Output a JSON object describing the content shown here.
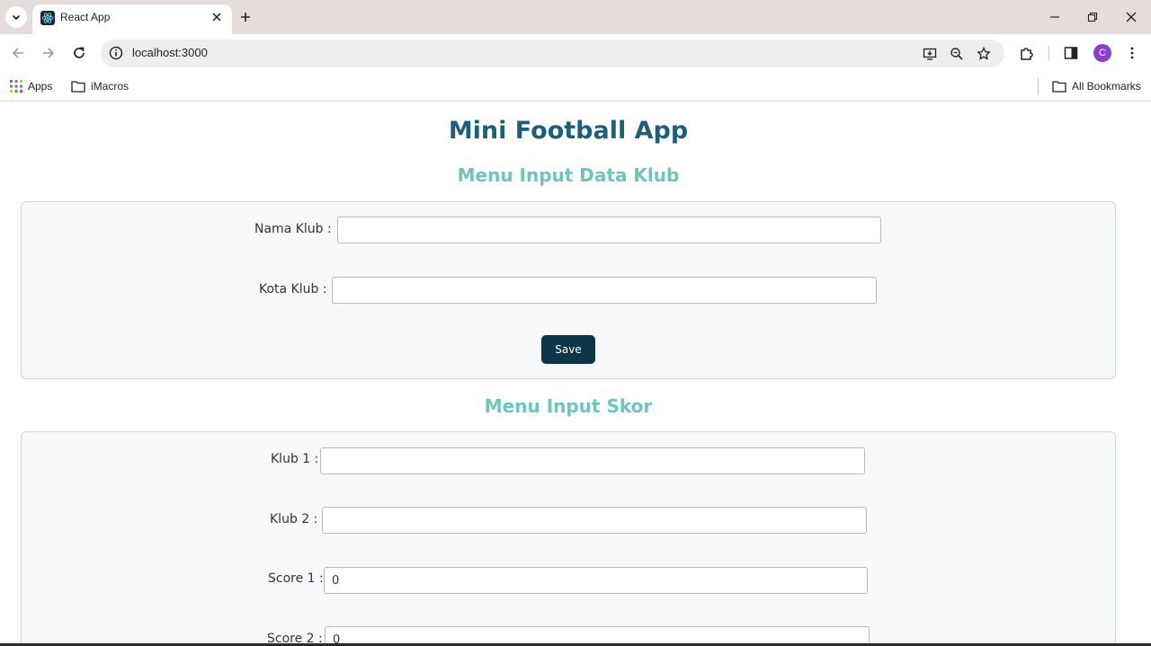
{
  "browser": {
    "tab_title": "React App",
    "url": "localhost:3000",
    "avatar_letter": "C",
    "bookmarks": [
      {
        "label": "Apps",
        "icon": "apps-grid-icon"
      },
      {
        "label": "iMacros",
        "icon": "folder-icon"
      }
    ],
    "all_bookmarks_label": "All Bookmarks"
  },
  "app": {
    "title": "Mini Football App",
    "club_section": {
      "title": "Menu Input Data Klub",
      "name_label": "Nama Klub :",
      "name_value": "",
      "city_label": "Kota Klub :",
      "city_value": "",
      "save_label": "Save"
    },
    "score_section": {
      "title": "Menu Input Skor",
      "club1_label": "Klub 1 :",
      "club1_value": "",
      "club2_label": "Klub 2 :",
      "club2_value": "",
      "score1_label": "Score 1 :",
      "score1_value": "0",
      "score2_label": "Score 2 :",
      "score2_value": "0"
    }
  },
  "colors": {
    "app_title": "#1c5f7a",
    "section_title": "#6cc6be",
    "save_button": "#0d3548",
    "avatar": "#8b3fd1"
  }
}
